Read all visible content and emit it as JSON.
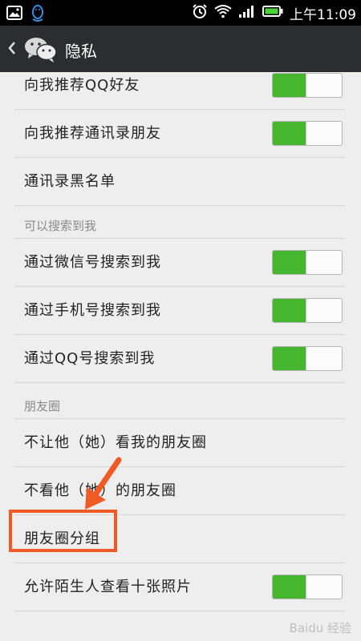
{
  "status_bar": {
    "time": "上午11:09"
  },
  "header": {
    "title": "隐私"
  },
  "rows": {
    "recommend_qq": "向我推荐QQ好友",
    "recommend_contacts": "向我推荐通讯录朋友",
    "blacklist": "通讯录黑名单",
    "section_searchable": "可以搜索到我",
    "search_wechat_id": "通过微信号搜索到我",
    "search_phone": "通过手机号搜索到我",
    "search_qq": "通过QQ号搜索到我",
    "section_moments": "朋友圈",
    "dont_let_see": "不让他（她）看我的朋友圈",
    "dont_see": "不看他（她）的朋友圈",
    "moments_groups": "朋友圈分组",
    "strangers_ten_photos": "允许陌生人查看十张照片"
  },
  "toggles": {
    "recommend_qq": true,
    "recommend_contacts": true,
    "search_wechat_id": true,
    "search_phone": true,
    "search_qq": true,
    "strangers_ten_photos": true
  },
  "colors": {
    "toggle_on": "#45b62d",
    "annotation": "#f05a24",
    "titlebar": "#2c2d31"
  },
  "watermark": "Baidu 经验"
}
